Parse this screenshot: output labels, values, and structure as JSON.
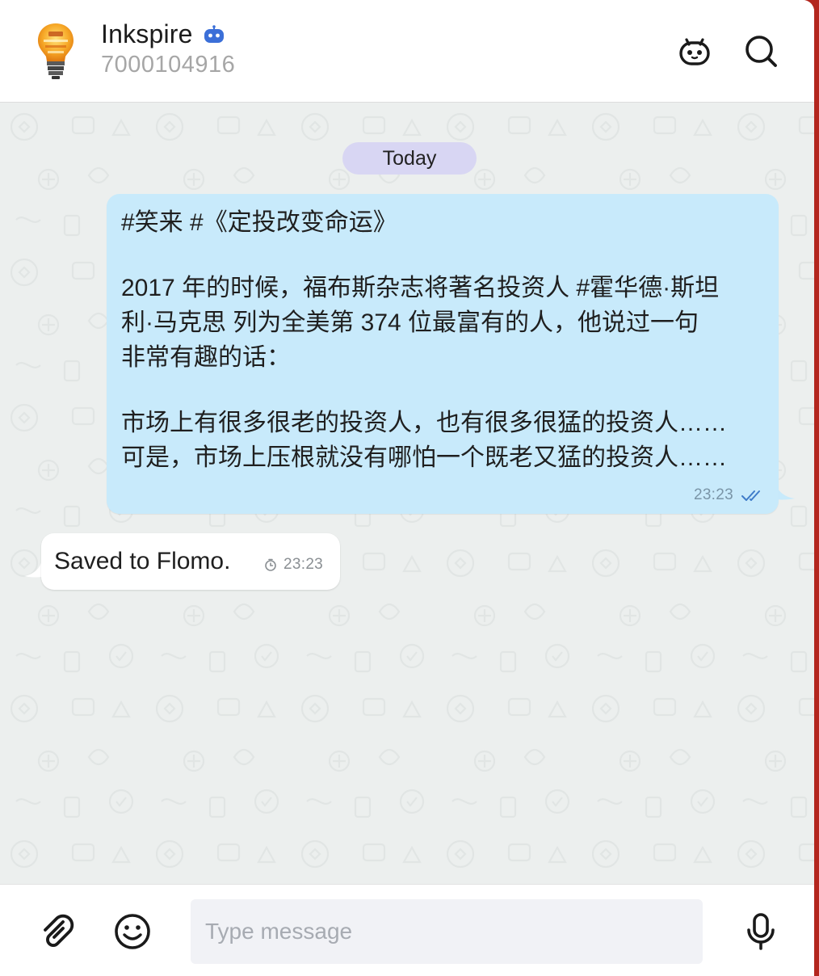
{
  "header": {
    "title": "Inkspire",
    "subtitle": "7000104916",
    "avatar_icon": "lightbulb-ideas-avatar",
    "badge_icon": "bot-badge-icon",
    "right_icons": [
      "bot-face-icon",
      "search-icon"
    ],
    "accent_color": "#3b82f6"
  },
  "chat": {
    "date_label": "Today",
    "outgoing_message": {
      "lines": [
        "#笑来 #《定投改变命运》",
        "2017 年的时候，福布斯杂志将著名投资人 #霍华德·斯坦",
        "利·马克思 列为全美第 374 位最富有的人，他说过一句",
        "非常有趣的话：",
        "市场上有很多很老的投资人，也有很多很猛的投资人……",
        "可是，市场上压根就没有哪怕一个既老又猛的投资人……"
      ],
      "time": "23:23",
      "status": "read",
      "bubble_color": "#c8eafb"
    },
    "incoming_message": {
      "text": "Saved to Flomo.",
      "time": "23:23",
      "status_icon": "clock-icon"
    }
  },
  "composer": {
    "placeholder": "Type message",
    "value": "",
    "icons": [
      "paperclip-icon",
      "emoji-icon",
      "microphone-icon"
    ]
  }
}
